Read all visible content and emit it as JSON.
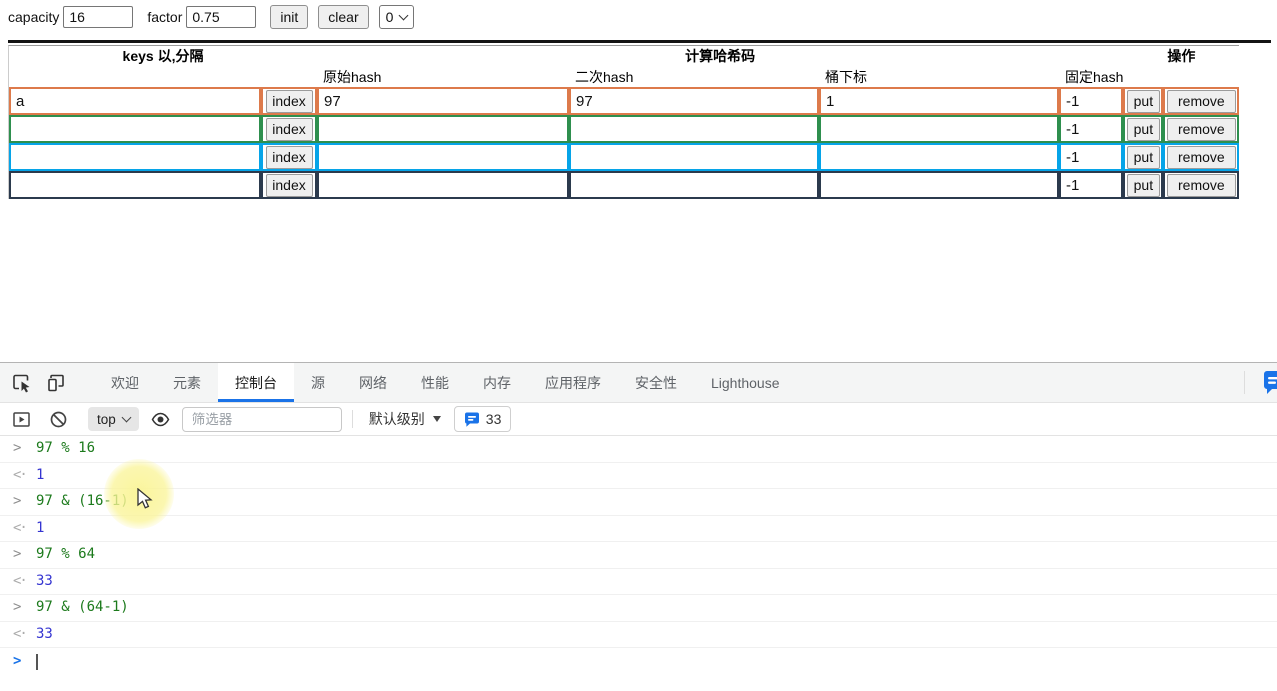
{
  "form": {
    "capacity_label": "capacity",
    "capacity_value": "16",
    "factor_label": "factor",
    "factor_value": "0.75",
    "init_label": "init",
    "clear_label": "clear",
    "select_value": "0"
  },
  "table": {
    "header_groups": {
      "keys": "keys 以,分隔",
      "hash": "计算哈希码",
      "ops": "操作"
    },
    "sub_headers": {
      "hash1": "原始hash",
      "hash2": "二次hash",
      "bucket": "桶下标",
      "fixed": "固定hash"
    },
    "index_label": "index",
    "put_label": "put",
    "remove_label": "remove",
    "rows": [
      {
        "key": "a",
        "hash1": "97",
        "hash2": "97",
        "bucket": "1",
        "fixed": "-1",
        "color": "#dd7a4b"
      },
      {
        "key": "",
        "hash1": "",
        "hash2": "",
        "bucket": "",
        "fixed": "-1",
        "color": "#2e8f4e"
      },
      {
        "key": "",
        "hash1": "",
        "hash2": "",
        "bucket": "",
        "fixed": "-1",
        "color": "#06a4e8"
      },
      {
        "key": "",
        "hash1": "",
        "hash2": "",
        "bucket": "",
        "fixed": "-1",
        "color": "#2b3a4d"
      }
    ]
  },
  "devtools": {
    "tabs": [
      {
        "label": "欢迎"
      },
      {
        "label": "元素"
      },
      {
        "label": "控制台"
      },
      {
        "label": "源"
      },
      {
        "label": "网络"
      },
      {
        "label": "性能"
      },
      {
        "label": "内存"
      },
      {
        "label": "应用程序"
      },
      {
        "label": "安全性"
      },
      {
        "label": "Lighthouse"
      }
    ],
    "active_tab": "控制台",
    "toolbar": {
      "context": "top",
      "filter_placeholder": "筛选器",
      "level_label": "默认级别",
      "issues_count": "33"
    },
    "console": {
      "entries": [
        {
          "kind": "command",
          "text": "97 % 16"
        },
        {
          "kind": "result",
          "text": "1"
        },
        {
          "kind": "command",
          "text": "97 & (16-1)"
        },
        {
          "kind": "result",
          "text": "1"
        },
        {
          "kind": "command",
          "text": "97 % 64"
        },
        {
          "kind": "result",
          "text": "33"
        },
        {
          "kind": "command",
          "text": "97 & (64-1)"
        },
        {
          "kind": "result",
          "text": "33"
        }
      ]
    }
  },
  "icons": [
    "inspect-icon",
    "device-toolbar-icon",
    "console-sidebar-icon",
    "block-icon",
    "eye-icon",
    "chevron-down-icon",
    "issues-bubble-icon",
    "feedback-bubble-icon",
    "mouse-cursor-icon"
  ],
  "colors": {
    "accent_blue": "#1a73e8",
    "row_orange": "#dd7a4b",
    "row_green": "#2e8f4e",
    "row_blue": "#06a4e8",
    "row_navy": "#2b3a4d",
    "console_command_green": "#1c7a1c",
    "console_result_blue": "#3535d1",
    "topline_black": "#141414"
  }
}
